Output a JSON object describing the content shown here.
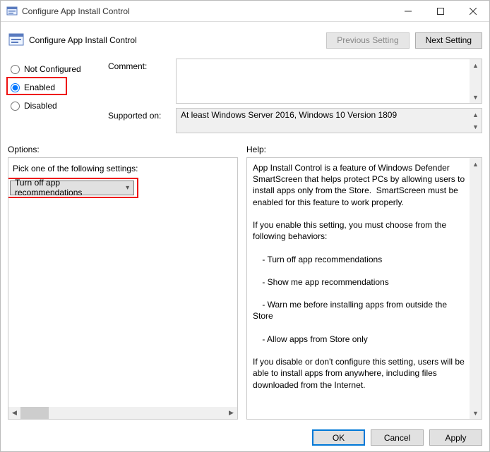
{
  "window": {
    "title": "Configure App Install Control"
  },
  "header": {
    "title": "Configure App Install Control",
    "prev": "Previous Setting",
    "next": "Next Setting"
  },
  "radios": {
    "not_configured": "Not Configured",
    "enabled": "Enabled",
    "disabled": "Disabled",
    "selected": "enabled"
  },
  "fields": {
    "comment_label": "Comment:",
    "comment_value": "",
    "supported_label": "Supported on:",
    "supported_value": "At least Windows Server 2016, Windows 10 Version 1809"
  },
  "sections": {
    "options": "Options:",
    "help": "Help:"
  },
  "options": {
    "prompt": "Pick one of the following settings:",
    "selected": "Turn off app recommendations"
  },
  "help_text": "App Install Control is a feature of Windows Defender SmartScreen that helps protect PCs by allowing users to install apps only from the Store.  SmartScreen must be enabled for this feature to work properly.\n\nIf you enable this setting, you must choose from the following behaviors:\n\n    - Turn off app recommendations\n\n    - Show me app recommendations\n\n    - Warn me before installing apps from outside the Store\n\n    - Allow apps from Store only\n\nIf you disable or don't configure this setting, users will be able to install apps from anywhere, including files downloaded from the Internet.",
  "footer": {
    "ok": "OK",
    "cancel": "Cancel",
    "apply": "Apply"
  }
}
